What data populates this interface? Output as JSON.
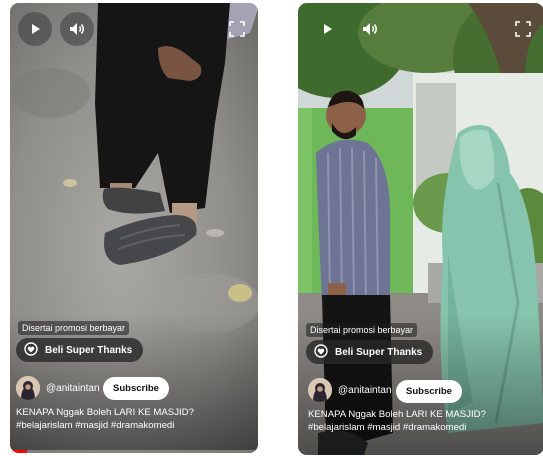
{
  "videos": [
    {
      "promo_label": "Disertai promosi berbayar",
      "thanks_label": "Beli Super Thanks",
      "channel": "@anitaintan",
      "subscribe_label": "Subscribe",
      "title": "KENAPA Nggak Boleh LARI KE MASJID?",
      "hashtags": "#belajarislam #masjid #dramakomedi",
      "progress": 0.07
    },
    {
      "promo_label": "Disertai promosi berbayar",
      "thanks_label": "Beli Super Thanks",
      "channel": "@anitaintan",
      "subscribe_label": "Subscribe",
      "title": "KENAPA Nggak Boleh LARI KE MASJID?",
      "hashtags": "#belajarislam #masjid #dramakomedi"
    }
  ],
  "icons": {
    "play": "play-icon",
    "volume": "volume-icon",
    "fullscreen": "fullscreen-icon",
    "super_thanks": "super-thanks-icon"
  },
  "colors": {
    "progress": "#ff0000",
    "subscribe_bg": "#ffffff",
    "thanks_bg": "#282828"
  }
}
